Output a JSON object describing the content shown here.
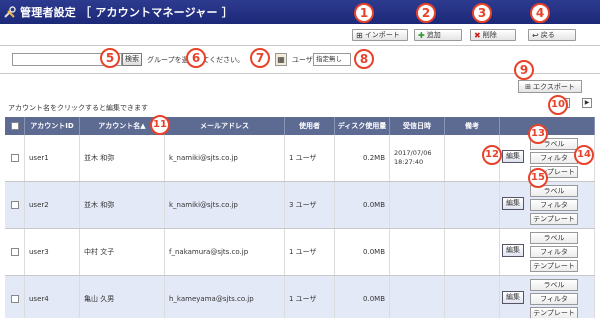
{
  "header": {
    "title": "管理者設定 ［ アカウントマネージャー ］",
    "icon": "wrench-screwdriver-icon"
  },
  "toolbar": [
    {
      "label": "インポート",
      "icon": "import-icon"
    },
    {
      "label": "追加",
      "icon": "plus-icon"
    },
    {
      "label": "削除",
      "icon": "delete-x-icon"
    },
    {
      "label": "戻る",
      "icon": "back-arrow-icon"
    }
  ],
  "search": {
    "button_label": "検索",
    "value": ""
  },
  "filter": {
    "group_label": "グループを選択してください。",
    "user_label": "ユーザ",
    "user_select_value": "指定無し"
  },
  "export_label": "エクスポート",
  "pager": {
    "prev": "◀",
    "next": "▶"
  },
  "hint": "アカウント名をクリックすると編集できます",
  "table": {
    "columns": [
      "",
      "アカウントID",
      "アカウント名▲",
      "メールアドレス",
      "使用者",
      "ディスク使用量",
      "受信日時",
      "備考",
      ""
    ],
    "rows": [
      {
        "id": "user1",
        "name": "並木 和弥",
        "email": "k_namiki@sjts.co.jp",
        "users": "1 ユーザ",
        "disk": "0.2MB",
        "received": "2017/07/06 18:27:40",
        "note": ""
      },
      {
        "id": "user2",
        "name": "並木 和弥",
        "email": "k_namiki@sjts.co.jp",
        "users": "3 ユーザ",
        "disk": "0.0MB",
        "received": "",
        "note": ""
      },
      {
        "id": "user3",
        "name": "中村 文子",
        "email": "f_nakamura@sjts.co.jp",
        "users": "1 ユーザ",
        "disk": "0.0MB",
        "received": "",
        "note": ""
      },
      {
        "id": "user4",
        "name": "亀山 久男",
        "email": "h_kameyama@sjts.co.jp",
        "users": "1 ユーザ",
        "disk": "0.0MB",
        "received": "",
        "note": ""
      }
    ],
    "row_actions": {
      "edit": "編集",
      "label": "ラベル",
      "filter": "フィルタ",
      "template": "テンプレート"
    }
  },
  "callouts": [
    "1",
    "2",
    "3",
    "4",
    "5",
    "6",
    "7",
    "8",
    "9",
    "10",
    "11",
    "12",
    "13",
    "14",
    "15"
  ],
  "colors": {
    "header_bg": "#1c2878",
    "table_header_bg": "#5d6b93",
    "row_alt_bg": "#e4e9f8",
    "callout": "#e8422a"
  }
}
